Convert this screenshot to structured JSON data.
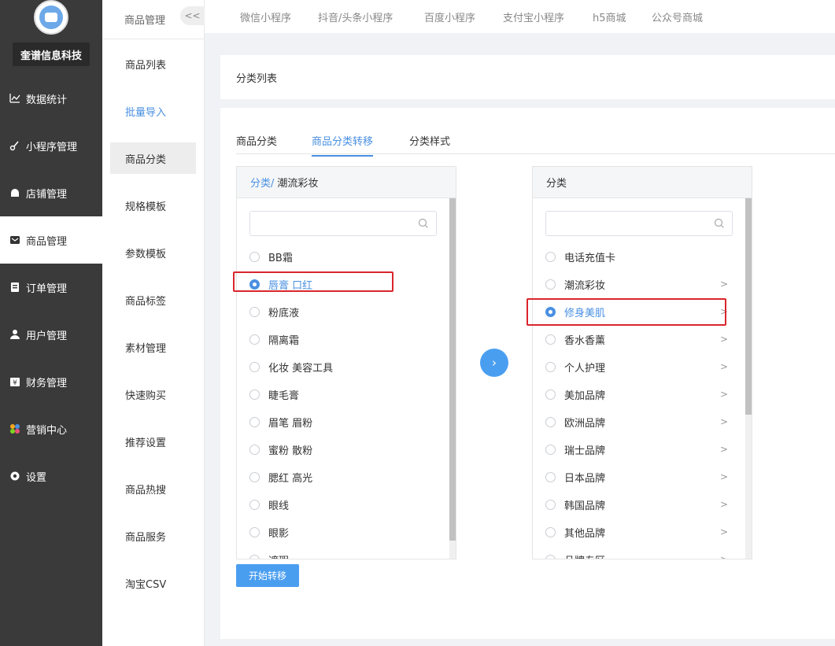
{
  "sidebar": {
    "company": "奎谱信息科技",
    "items": [
      {
        "label": "数据统计",
        "icon": "chart-icon"
      },
      {
        "label": "小程序管理",
        "icon": "link-icon"
      },
      {
        "label": "店铺管理",
        "icon": "store-icon"
      },
      {
        "label": "商品管理",
        "icon": "mail-icon"
      },
      {
        "label": "订单管理",
        "icon": "clipboard-icon"
      },
      {
        "label": "用户管理",
        "icon": "user-icon"
      },
      {
        "label": "财务管理",
        "icon": "finance-icon"
      },
      {
        "label": "营销中心",
        "icon": "marketing-icon"
      },
      {
        "label": "设置",
        "icon": "gear-icon"
      }
    ],
    "active_index": 3
  },
  "subbar": {
    "title": "商品管理",
    "collapse_label": "<<",
    "items": [
      "商品列表",
      "批量导入",
      "商品分类",
      "规格模板",
      "参数模板",
      "商品标签",
      "素材管理",
      "快速购买",
      "推荐设置",
      "商品热搜",
      "商品服务",
      "淘宝CSV"
    ],
    "highlight_index": 1,
    "active_index": 2
  },
  "top_tabs": [
    "微信小程序",
    "抖音/头条小程序",
    "百度小程序",
    "支付宝小程序",
    "h5商城",
    "公众号商城"
  ],
  "panel_title": "分类列表",
  "inner_tabs": [
    "商品分类",
    "商品分类转移",
    "分类样式"
  ],
  "inner_tab_active": 1,
  "left_box": {
    "crumb_link": "分类/",
    "crumb_current": "潮流彩妆",
    "items": [
      "BB霜",
      "唇膏 口红",
      "粉底液",
      "隔离霜",
      "化妆 美容工具",
      "睫毛膏",
      "眉笔 眉粉",
      "蜜粉 散粉",
      "腮红 高光",
      "眼线",
      "眼影",
      "遮瑕"
    ],
    "checked_index": 1
  },
  "right_box": {
    "header": "分类",
    "items": [
      {
        "label": "电话充值卡",
        "chevron": false
      },
      {
        "label": "潮流彩妆",
        "chevron": true
      },
      {
        "label": "修身美肌",
        "chevron": true
      },
      {
        "label": "香水香薰",
        "chevron": true
      },
      {
        "label": "个人护理",
        "chevron": true
      },
      {
        "label": "美加品牌",
        "chevron": true
      },
      {
        "label": "欧洲品牌",
        "chevron": true
      },
      {
        "label": "瑞士品牌",
        "chevron": true
      },
      {
        "label": "日本品牌",
        "chevron": true
      },
      {
        "label": "韩国品牌",
        "chevron": true
      },
      {
        "label": "其他品牌",
        "chevron": true
      },
      {
        "label": "品牌专区",
        "chevron": true
      }
    ],
    "checked_index": 2
  },
  "transfer_button": "›",
  "start_button": "开始转移",
  "colors": {
    "accent": "#4a90e2",
    "sidebar_bg": "#3a3a3a",
    "highlight_border": "#d9262c"
  }
}
